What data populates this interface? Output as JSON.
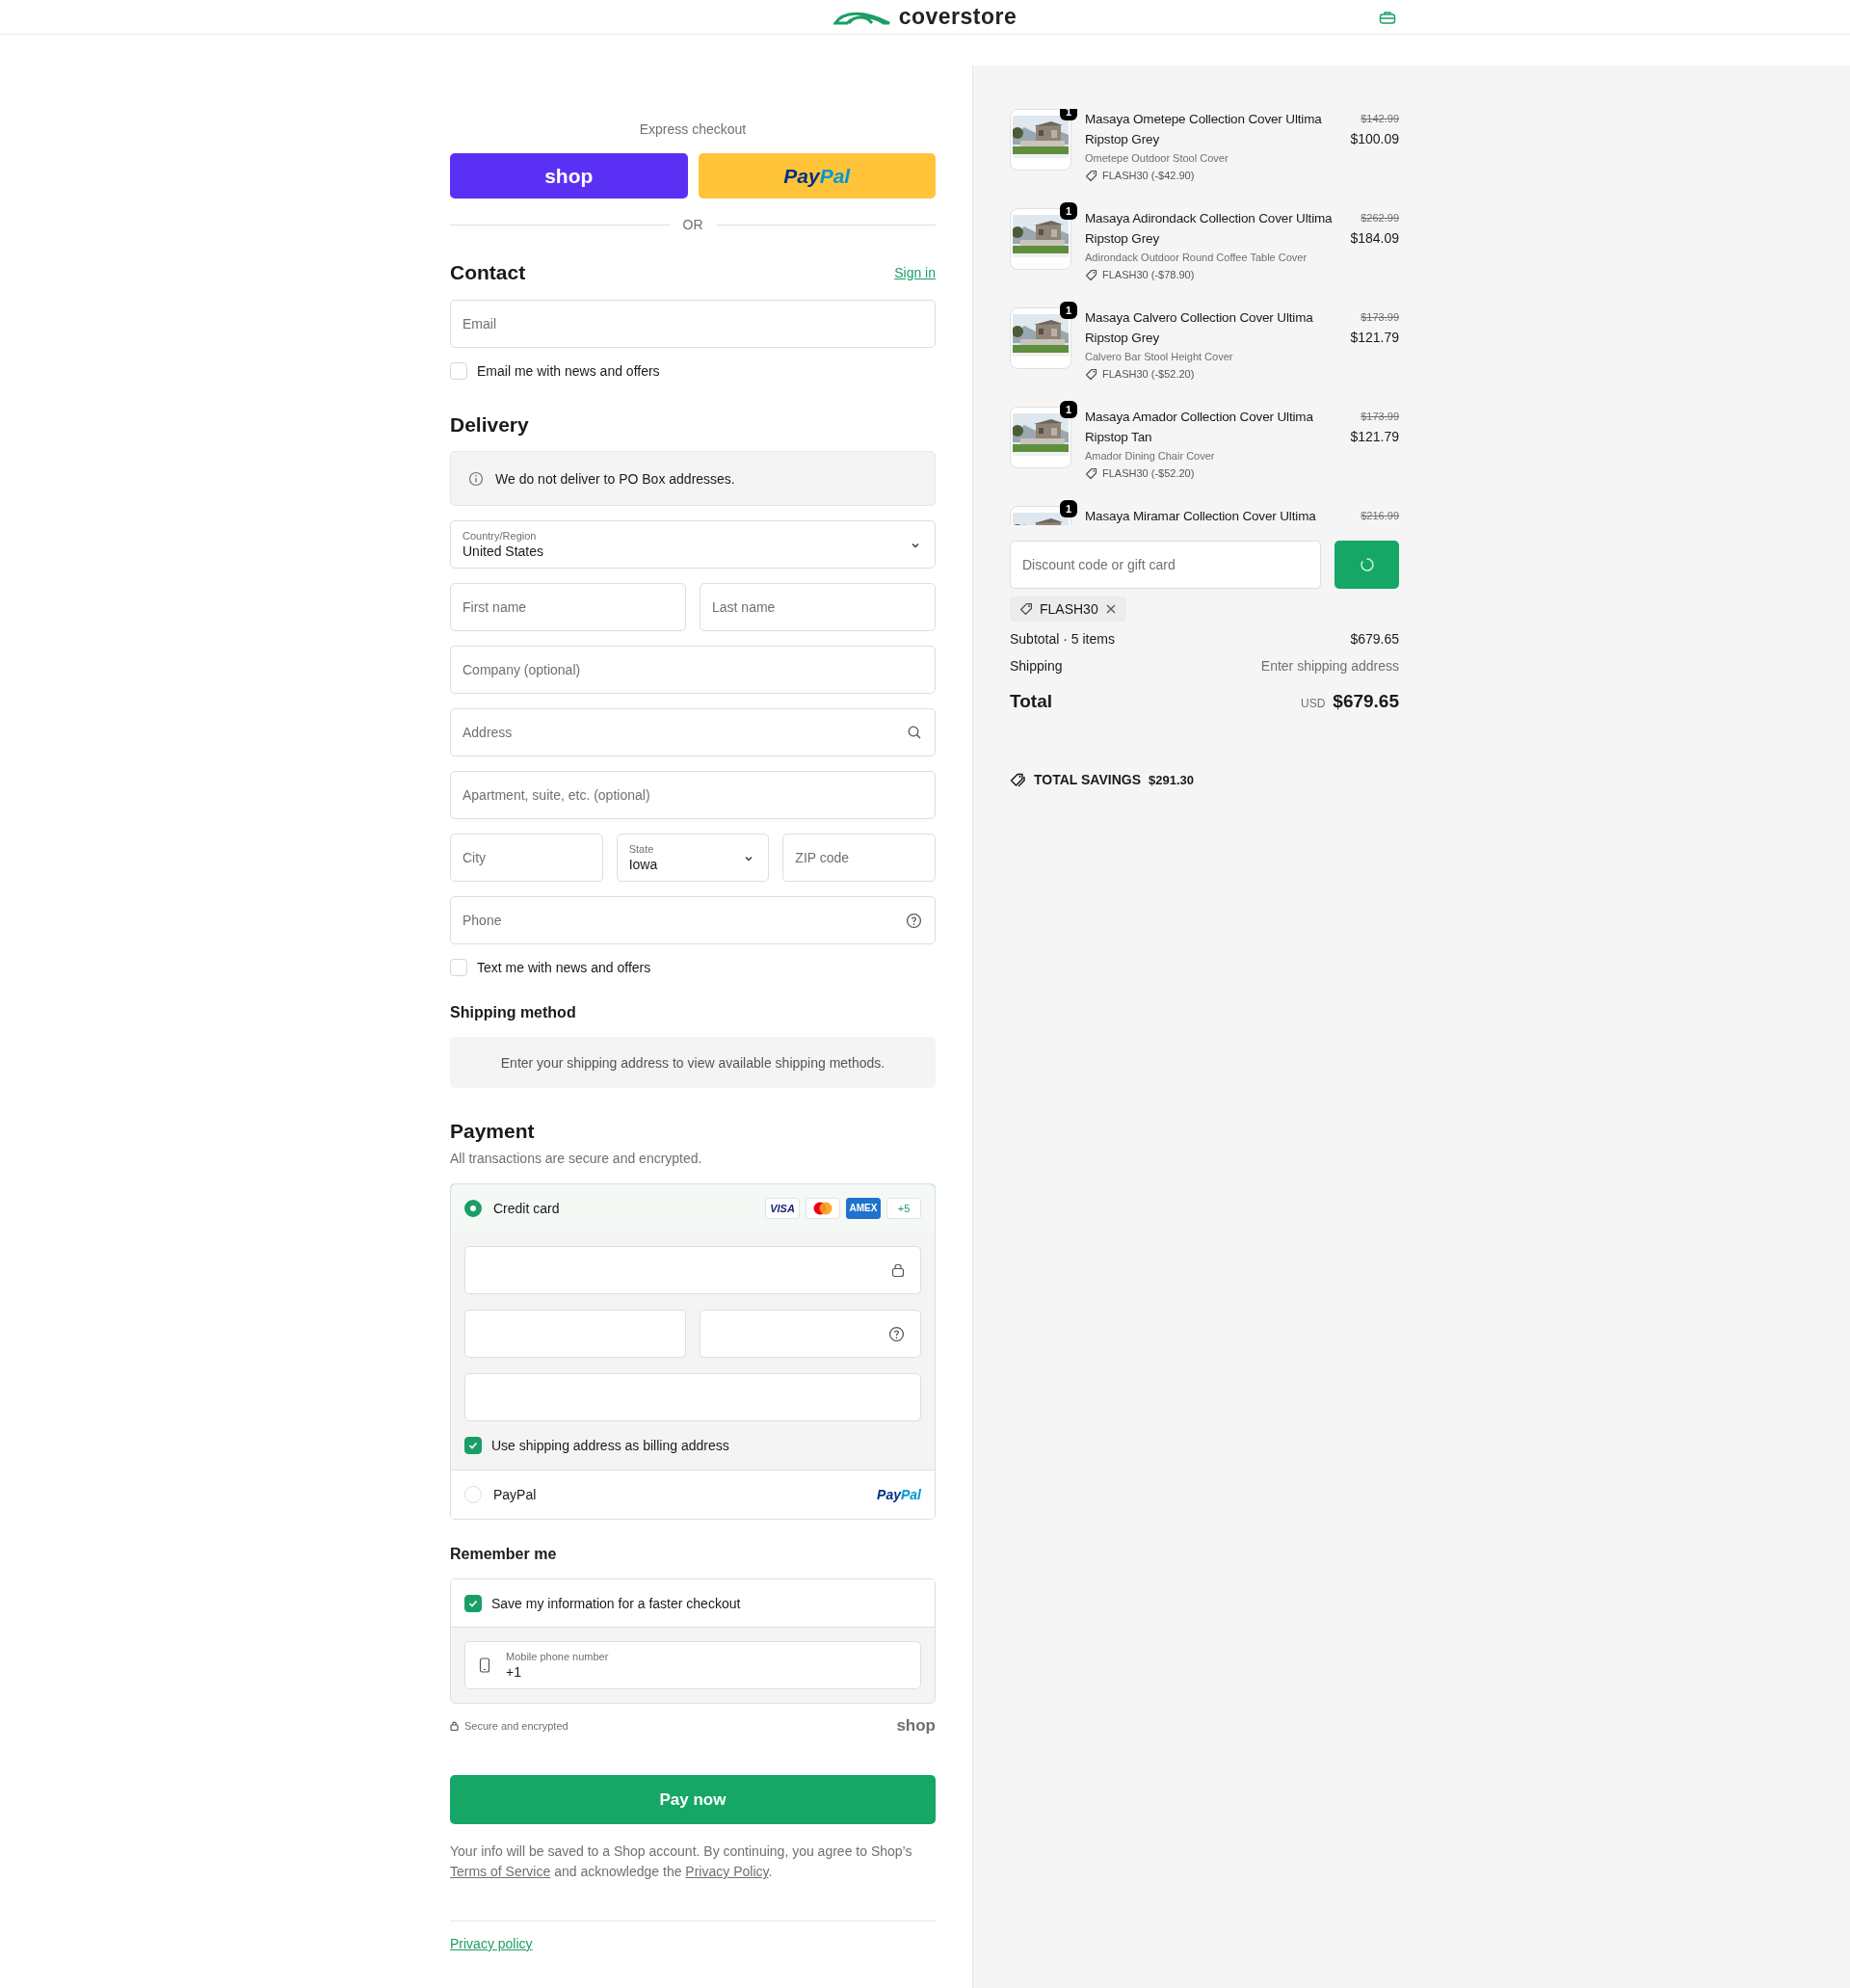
{
  "header": {
    "logo": "coverstore"
  },
  "express": {
    "title": "Express checkout",
    "buttons": [
      {
        "kind": "shop",
        "label": "shop"
      },
      {
        "kind": "paypal",
        "label_parts": [
          "Pay",
          "Pal"
        ]
      }
    ],
    "divider": "OR"
  },
  "contact": {
    "heading": "Contact",
    "sign_in": "Sign in",
    "email": {
      "placeholder": "Email"
    },
    "newsletter": {
      "label": "Email me with news and offers",
      "checked": false
    }
  },
  "delivery": {
    "heading": "Delivery",
    "notice": "We do not deliver to PO Box addresses.",
    "rows": [
      [
        {
          "kind": "select",
          "label": "Country/Region",
          "value": "United States"
        }
      ],
      [
        {
          "kind": "text",
          "placeholder": "First name"
        },
        {
          "kind": "text",
          "placeholder": "Last name"
        }
      ],
      [
        {
          "kind": "text",
          "placeholder": "Company (optional)"
        }
      ],
      [
        {
          "kind": "search",
          "placeholder": "Address"
        }
      ],
      [
        {
          "kind": "text",
          "placeholder": "Apartment, suite, etc. (optional)"
        }
      ],
      [
        {
          "kind": "text",
          "placeholder": "City"
        },
        {
          "kind": "select",
          "label": "State",
          "value": "Iowa"
        },
        {
          "kind": "text",
          "placeholder": "ZIP code"
        }
      ],
      [
        {
          "kind": "help",
          "placeholder": "Phone"
        }
      ]
    ],
    "sms": {
      "label": "Text me with news and offers",
      "checked": false
    }
  },
  "shipping_method": {
    "heading": "Shipping method",
    "message": "Enter your shipping address to view available shipping methods."
  },
  "payment": {
    "heading": "Payment",
    "subtitle": "All transactions are secure and encrypted.",
    "methods": [
      {
        "kind": "card",
        "label": "Credit card",
        "selected": true,
        "badges": [
          {
            "kind": "visa",
            "text": "VISA"
          },
          {
            "kind": "mastercard"
          },
          {
            "kind": "amex",
            "text": "AMEX"
          },
          {
            "kind": "more",
            "text": "+5"
          }
        ]
      },
      {
        "kind": "paypal",
        "label": "PayPal",
        "selected": false,
        "logo_parts": [
          "Pay",
          "Pal"
        ]
      }
    ],
    "card_fields": [
      [
        {
          "kind": "lock"
        }
      ],
      [
        {
          "kind": "plain"
        },
        {
          "kind": "help"
        }
      ],
      [
        {
          "kind": "plain"
        }
      ]
    ],
    "billing": {
      "label": "Use shipping address as billing address",
      "checked": true
    }
  },
  "remember": {
    "heading": "Remember me",
    "save": {
      "label": "Save my information for a faster checkout",
      "checked": true
    },
    "phone": {
      "label": "Mobile phone number",
      "value": "+1"
    },
    "secure": "Secure and encrypted",
    "brand": "shop"
  },
  "pay_button": "Pay now",
  "legal": [
    {
      "text": "Your info will be saved to a Shop account. By continuing, you agree to Shop’s ",
      "link": false
    },
    {
      "text": "Terms of Service",
      "link": true
    },
    {
      "text": " and acknowledge the ",
      "link": false
    },
    {
      "text": "Privacy Policy",
      "link": true
    },
    {
      "text": ".",
      "link": false
    }
  ],
  "footer_links": [
    "Privacy policy"
  ],
  "cart": {
    "items": [
      {
        "qty": "1",
        "name": "Masaya Ometepe Collection Cover Ultima Ripstop Grey",
        "variant": "Ometepe Outdoor Stool Cover",
        "discount": "FLASH30 (-$42.90)",
        "compare_price": "$142.99",
        "price": "$100.09"
      },
      {
        "qty": "1",
        "name": "Masaya Adirondack Collection Cover Ultima Ripstop Grey",
        "variant": "Adirondack Outdoor Round Coffee Table Cover",
        "discount": "FLASH30 (-$78.90)",
        "compare_price": "$262.99",
        "price": "$184.09"
      },
      {
        "qty": "1",
        "name": "Masaya Calvero Collection Cover Ultima Ripstop Grey",
        "variant": "Calvero Bar Stool Height Cover",
        "discount": "FLASH30 (-$52.20)",
        "compare_price": "$173.99",
        "price": "$121.79"
      },
      {
        "qty": "1",
        "name": "Masaya Amador Collection Cover Ultima Ripstop Tan",
        "variant": "Amador Dining Chair Cover",
        "discount": "FLASH30 (-$52.20)",
        "compare_price": "$173.99",
        "price": "$121.79"
      },
      {
        "qty": "1",
        "name": "Masaya Miramar Collection Cover Ultima",
        "compare_price": "$216.99"
      }
    ],
    "discount": {
      "placeholder": "Discount code or gift card",
      "applied": "FLASH30"
    },
    "subtotal": {
      "label": "Subtotal · 5 items",
      "value": "$679.65"
    },
    "shipping": {
      "label": "Shipping",
      "value": "Enter shipping address"
    },
    "total": {
      "label": "Total",
      "currency": "USD",
      "value": "$679.65"
    },
    "savings": {
      "label": "TOTAL SAVINGS",
      "value": "$291.30"
    }
  }
}
